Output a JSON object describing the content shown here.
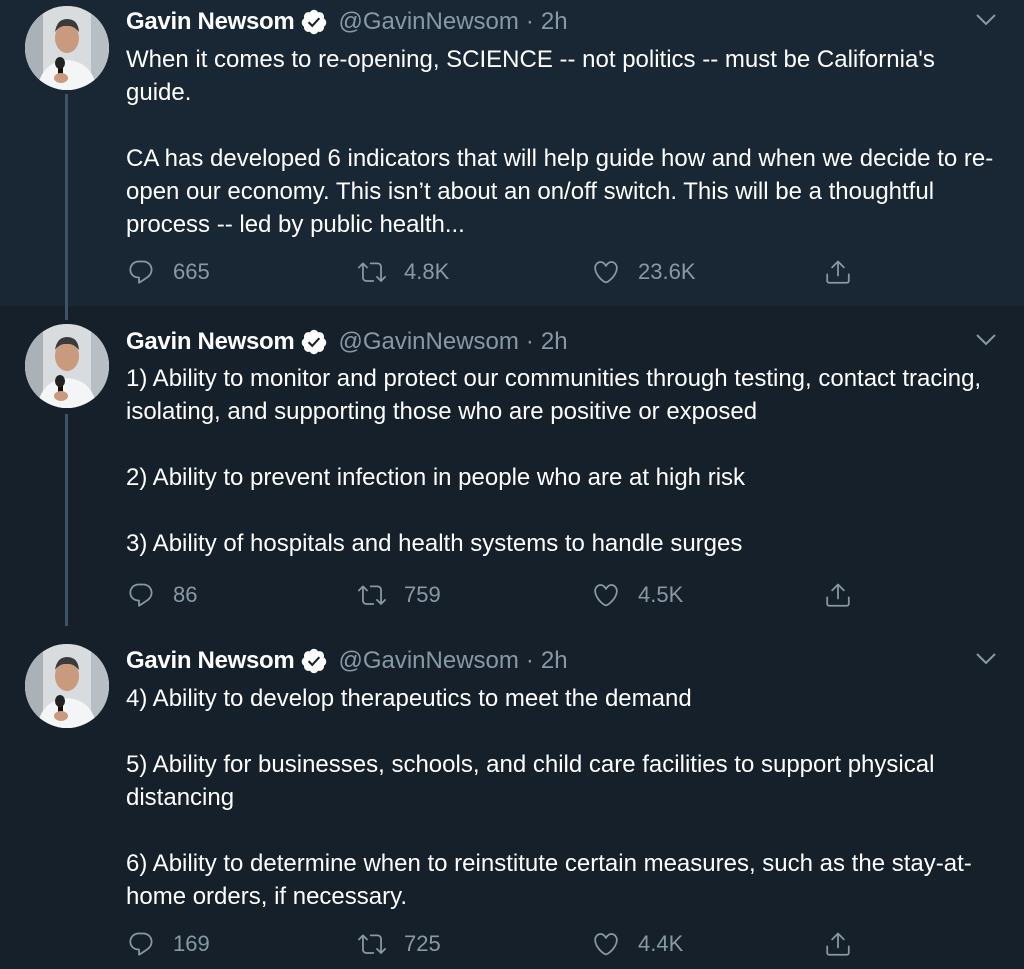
{
  "tweets": [
    {
      "author": {
        "name": "Gavin Newsom",
        "handle": "@GavinNewsom"
      },
      "separator": "·",
      "time": "2h",
      "paragraphs": [
        "When it comes to re-opening, SCIENCE -- not politics -- must be California's guide.",
        "CA has developed 6 indicators that will help guide how and when we decide to re-open our economy. This isn’t about an on/off switch. This will be a thoughtful process -- led by public health..."
      ],
      "stats": {
        "replies": "665",
        "retweets": "4.8K",
        "likes": "23.6K"
      }
    },
    {
      "author": {
        "name": "Gavin Newsom",
        "handle": "@GavinNewsom"
      },
      "separator": "·",
      "time": "2h",
      "paragraphs": [
        "1) Ability to monitor and protect our communities through testing, contact tracing, isolating, and supporting those who are positive or exposed",
        "2) Ability to prevent infection in people who are at high risk",
        "3) Ability of hospitals and health systems to handle surges"
      ],
      "stats": {
        "replies": "86",
        "retweets": "759",
        "likes": "4.5K"
      }
    },
    {
      "author": {
        "name": "Gavin Newsom",
        "handle": "@GavinNewsom"
      },
      "separator": "·",
      "time": "2h",
      "paragraphs": [
        "4) Ability to develop therapeutics to meet the demand",
        "5) Ability for businesses, schools, and child care facilities to support physical distancing",
        "6) Ability to determine when to reinstitute certain measures, such as the stay-at-home orders, if necessary."
      ],
      "stats": {
        "replies": "169",
        "retweets": "725",
        "likes": "4.4K"
      }
    }
  ],
  "colors": {
    "background": "#15202b",
    "highlighted_background": "#192734",
    "text": "#ffffff",
    "secondary_text": "#8899a6",
    "verified_badge": "#ffffff"
  },
  "icons": [
    "verified-badge-icon",
    "chevron-down-icon",
    "reply-icon",
    "retweet-icon",
    "like-icon",
    "share-icon"
  ]
}
